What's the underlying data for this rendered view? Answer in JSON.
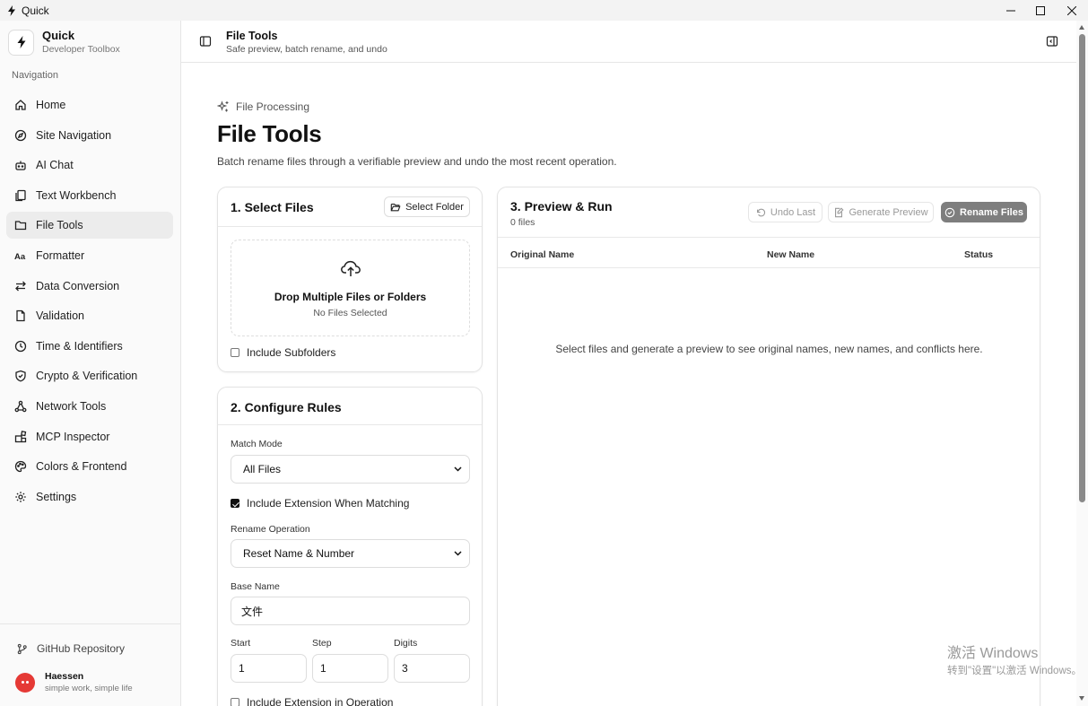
{
  "window": {
    "title": "Quick"
  },
  "sidebar": {
    "brand_name": "Quick",
    "brand_sub": "Developer Toolbox",
    "heading": "Navigation",
    "items": [
      {
        "label": "Home",
        "icon": "home-icon"
      },
      {
        "label": "Site Navigation",
        "icon": "compass-icon"
      },
      {
        "label": "AI Chat",
        "icon": "bot-icon"
      },
      {
        "label": "Text Workbench",
        "icon": "document-copy-icon"
      },
      {
        "label": "File Tools",
        "icon": "folder-icon",
        "active": true
      },
      {
        "label": "Formatter",
        "icon": "typography-icon"
      },
      {
        "label": "Data Conversion",
        "icon": "arrows-swap-icon"
      },
      {
        "label": "Validation",
        "icon": "document-check-icon"
      },
      {
        "label": "Time & Identifiers",
        "icon": "clock-icon"
      },
      {
        "label": "Crypto & Verification",
        "icon": "shield-icon"
      },
      {
        "label": "Network Tools",
        "icon": "network-icon"
      },
      {
        "label": "MCP Inspector",
        "icon": "blocks-icon"
      },
      {
        "label": "Colors & Frontend",
        "icon": "palette-icon"
      },
      {
        "label": "Settings",
        "icon": "gear-icon"
      }
    ],
    "github": "GitHub Repository",
    "user_name": "Haessen",
    "user_sub": "simple work, simple life"
  },
  "header": {
    "title": "File Tools",
    "subtitle": "Safe preview, batch rename, and undo"
  },
  "page": {
    "crumb": "File Processing",
    "title": "File Tools",
    "description": "Batch rename files through a verifiable preview and undo the most recent operation."
  },
  "select_files": {
    "title": "1. Select Files",
    "select_folder": "Select Folder",
    "drop_title": "Drop Multiple Files or Folders",
    "drop_sub": "No Files Selected",
    "include_subfolders": "Include Subfolders"
  },
  "rules": {
    "title": "2. Configure Rules",
    "match_mode_label": "Match Mode",
    "match_mode_value": "All Files",
    "include_ext_matching": "Include Extension When Matching",
    "rename_op_label": "Rename Operation",
    "rename_op_value": "Reset Name & Number",
    "base_name_label": "Base Name",
    "base_name_value": "文件",
    "start_label": "Start",
    "start_value": "1",
    "step_label": "Step",
    "step_value": "1",
    "digits_label": "Digits",
    "digits_value": "3",
    "include_ext_operation": "Include Extension in Operation"
  },
  "preview": {
    "title": "3. Preview & Run",
    "count": "0 files",
    "undo": "Undo Last",
    "generate": "Generate Preview",
    "rename": "Rename Files",
    "columns": [
      "Original Name",
      "New Name",
      "Status"
    ],
    "empty": "Select files and generate a preview to see original names, new names, and conflicts here."
  },
  "watermark": {
    "line1": "激活 Windows",
    "line2": "转到\"设置\"以激活 Windows。"
  },
  "colors": {
    "accent": "#7e7e7e",
    "avatar": "#e53935"
  }
}
